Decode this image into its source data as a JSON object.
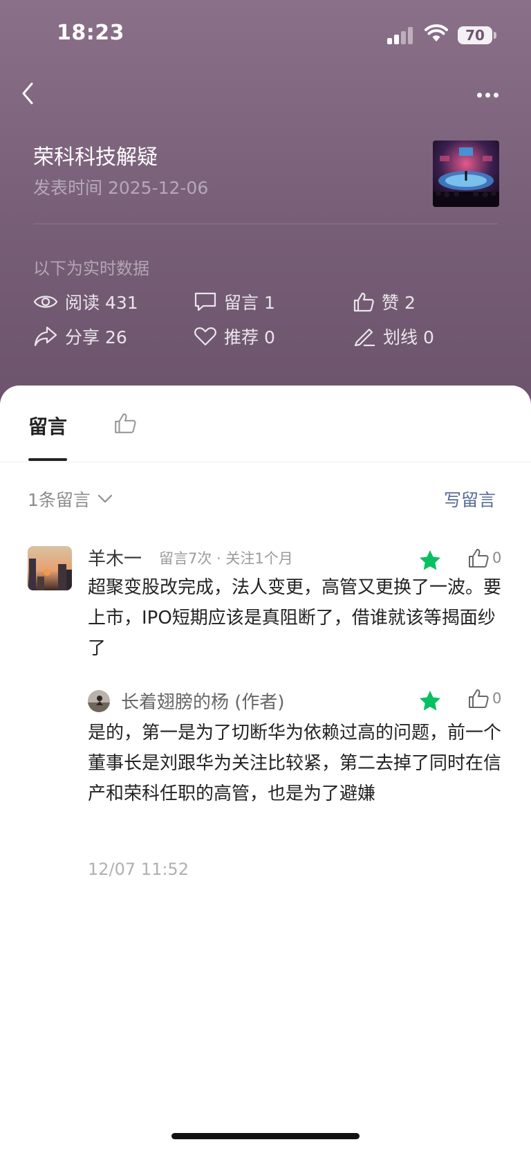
{
  "status_bar": {
    "time": "18:23",
    "battery": "70"
  },
  "article": {
    "title": "荣科科技解疑",
    "date": "发表时间 2025-12-06"
  },
  "stats": {
    "realtime_label": "以下为实时数据",
    "items": [
      {
        "icon": "eye-icon",
        "label": "阅读 431"
      },
      {
        "icon": "comment-icon",
        "label": "留言 1"
      },
      {
        "icon": "thumbs-up-icon",
        "label": "赞 2"
      },
      {
        "icon": "share-icon",
        "label": "分享 26"
      },
      {
        "icon": "heart-icon",
        "label": "推荐 0"
      },
      {
        "icon": "pen-icon",
        "label": "划线 0"
      }
    ]
  },
  "tabs": {
    "comments_label": "留言",
    "likes_icon": "thumbs-up-icon"
  },
  "comments_header": {
    "count_label": "1条留言",
    "write_label": "写留言"
  },
  "comment": {
    "author": "羊木一",
    "meta": "留言7次 · 关注1个月",
    "likes": "0",
    "text": "超聚变股改完成，法人变更，高管又更换了一波。要上市，IPO短期应该是真阻断了，借谁就该等揭面纱了",
    "reply": {
      "author": "长着翅膀的杨 (作者)",
      "likes": "0",
      "text": "是的，第一是为了切断华为依赖过高的问题，前一个董事长是刘跟华为关注比较紧，第二去掉了同时在信产和荣科任职的高管，也是为了避嫌"
    },
    "time": "12/07 11:52"
  },
  "colors": {
    "header_bg": "#7a627a",
    "accent_green": "#07c160",
    "link_blue": "#576b95"
  }
}
